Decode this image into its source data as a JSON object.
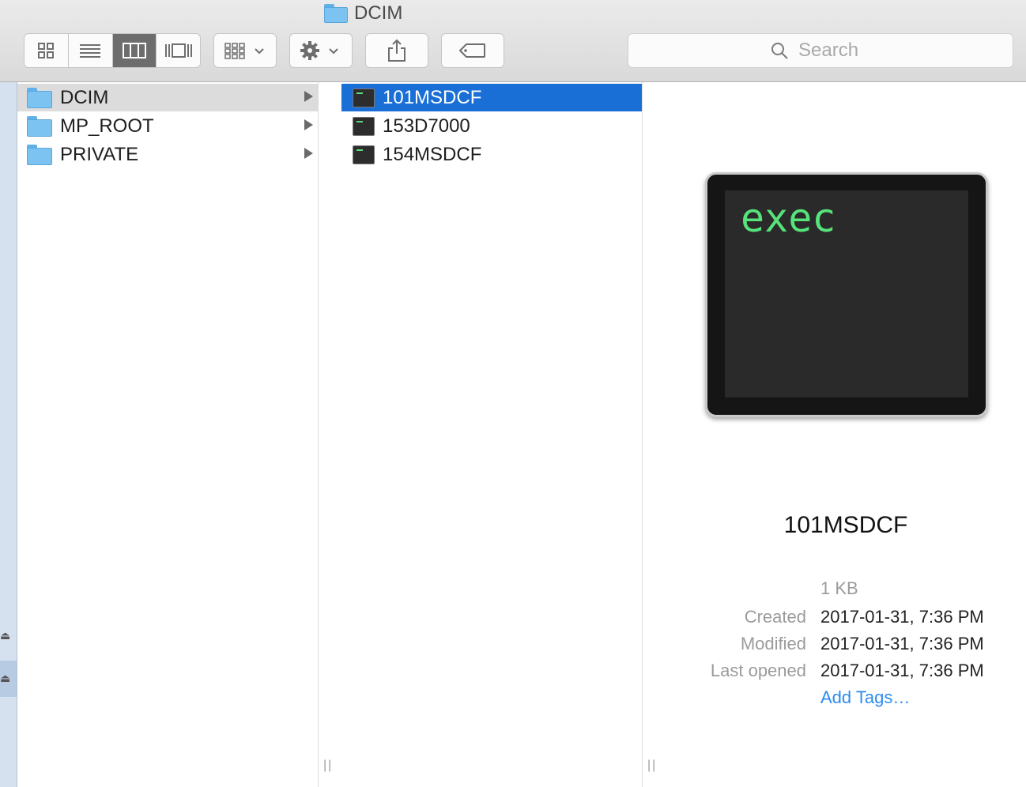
{
  "window": {
    "title": "DCIM"
  },
  "toolbar": {
    "view_modes": [
      "icon-view",
      "list-view",
      "column-view",
      "coverflow-view"
    ],
    "active_view": "column-view",
    "search_placeholder": "Search"
  },
  "columns": {
    "first": [
      {
        "name": "DCIM",
        "selected": true
      },
      {
        "name": "MP_ROOT",
        "selected": false
      },
      {
        "name": "PRIVATE",
        "selected": false
      }
    ],
    "second": [
      {
        "name": "101MSDCF",
        "selected": true
      },
      {
        "name": "153D7000",
        "selected": false
      },
      {
        "name": "154MSDCF",
        "selected": false
      }
    ]
  },
  "preview": {
    "icon_text": "exec",
    "name": "101MSDCF",
    "size": "1 KB",
    "meta": [
      {
        "label": "Created",
        "value": "2017-01-31, 7:36 PM"
      },
      {
        "label": "Modified",
        "value": "2017-01-31, 7:36 PM"
      },
      {
        "label": "Last opened",
        "value": "2017-01-31, 7:36 PM"
      }
    ],
    "add_tags": "Add Tags…"
  },
  "colors": {
    "selection_blue": "#1a6fd6",
    "terminal_green": "#55e37a",
    "link_blue": "#2b8cf0"
  }
}
